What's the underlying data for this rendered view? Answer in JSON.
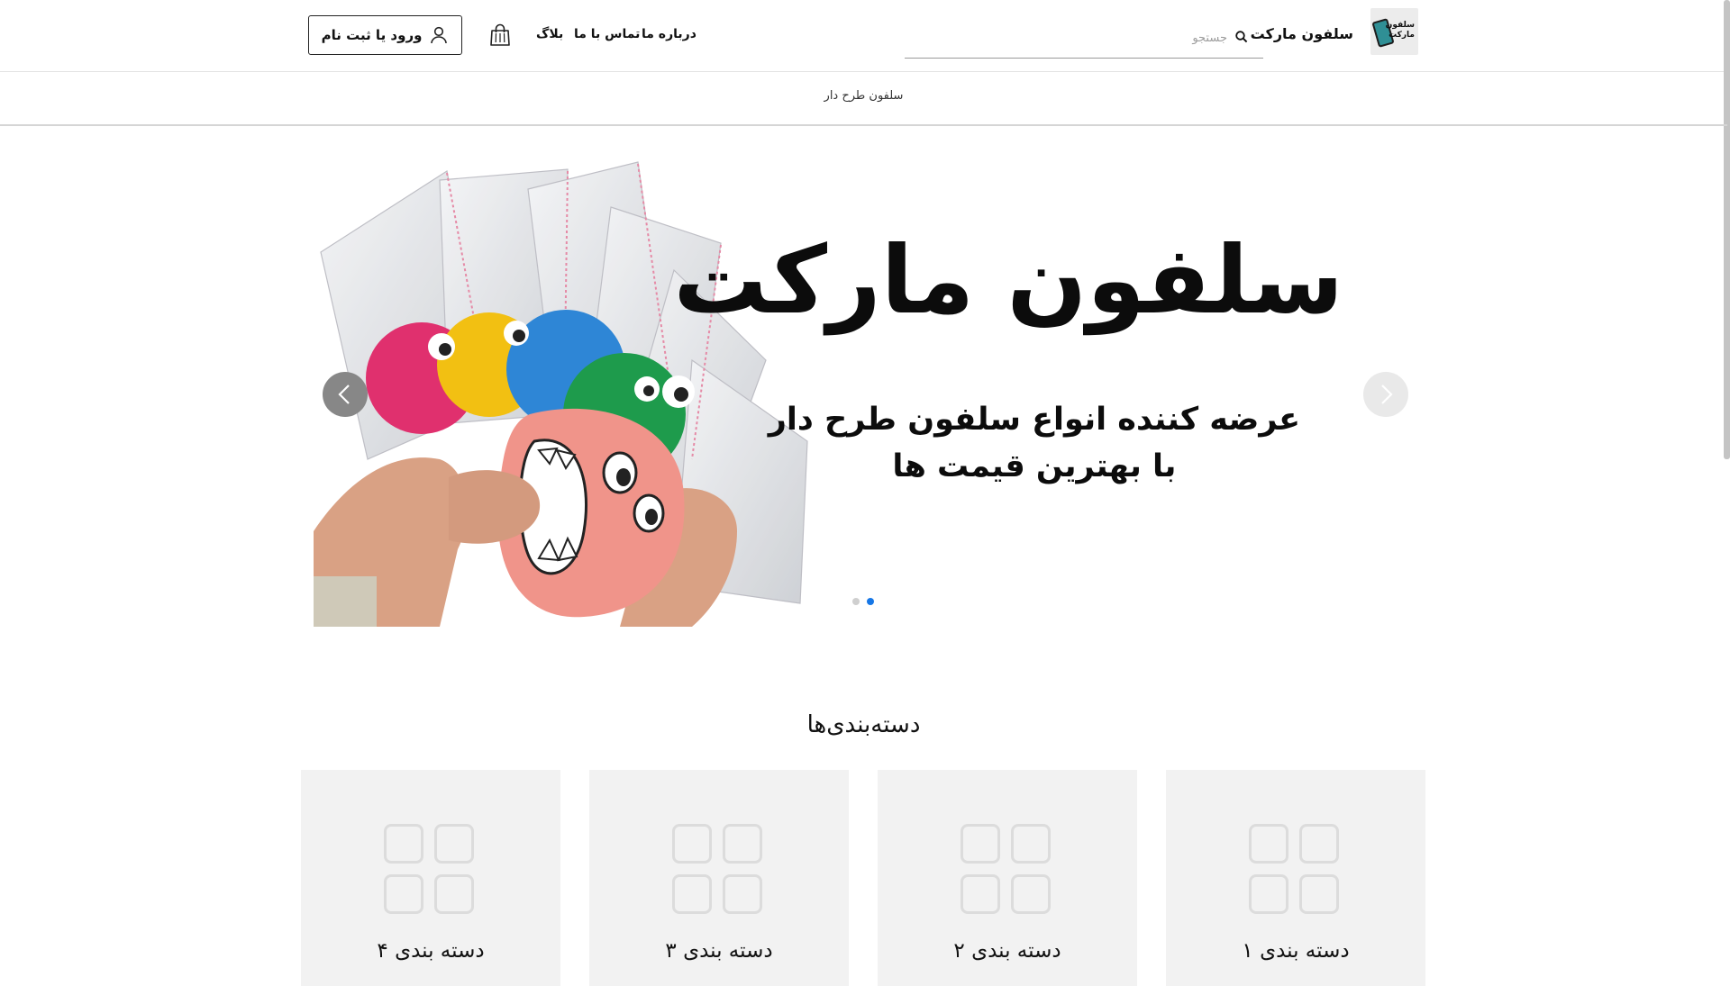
{
  "header": {
    "logo_text": "سلفون مارکت",
    "brand_name": "سلفون مارکت",
    "search": {
      "placeholder": "جستجو",
      "value": "",
      "icon": "search-icon"
    },
    "nav": [
      {
        "label": "درباره ما"
      },
      {
        "label": "تماس با ما"
      },
      {
        "label": "بلاگ"
      }
    ],
    "cart_icon": "shopping-bag-icon",
    "login_label": "ورود یا ثبت نام",
    "login_icon": "user-icon"
  },
  "submenu": {
    "items": [
      {
        "label": "سلفون طرح دار"
      }
    ]
  },
  "hero": {
    "title": "سلفون مارکت",
    "subtitle_line1": "عرضه کننده انواع سلفون طرح دار",
    "subtitle_line2": "با بهترین قیمت ها",
    "prev_icon": "chevron-left-icon",
    "next_icon": "chevron-right-icon",
    "slides_count": 2,
    "active_slide": 2
  },
  "categories": {
    "title": "دسته‌بندی‌ها",
    "items": [
      {
        "label": "دسته بندی ۱",
        "icon": "grid-icon"
      },
      {
        "label": "دسته بندی ۲",
        "icon": "grid-icon"
      },
      {
        "label": "دسته بندی ۳",
        "icon": "grid-icon"
      },
      {
        "label": "دسته بندی ۴",
        "icon": "grid-icon"
      }
    ]
  },
  "colors": {
    "accent": "#1677e6",
    "card_bg": "#f2f2f2",
    "arrow_dark": "#878787",
    "arrow_light": "#e9e9e9"
  }
}
